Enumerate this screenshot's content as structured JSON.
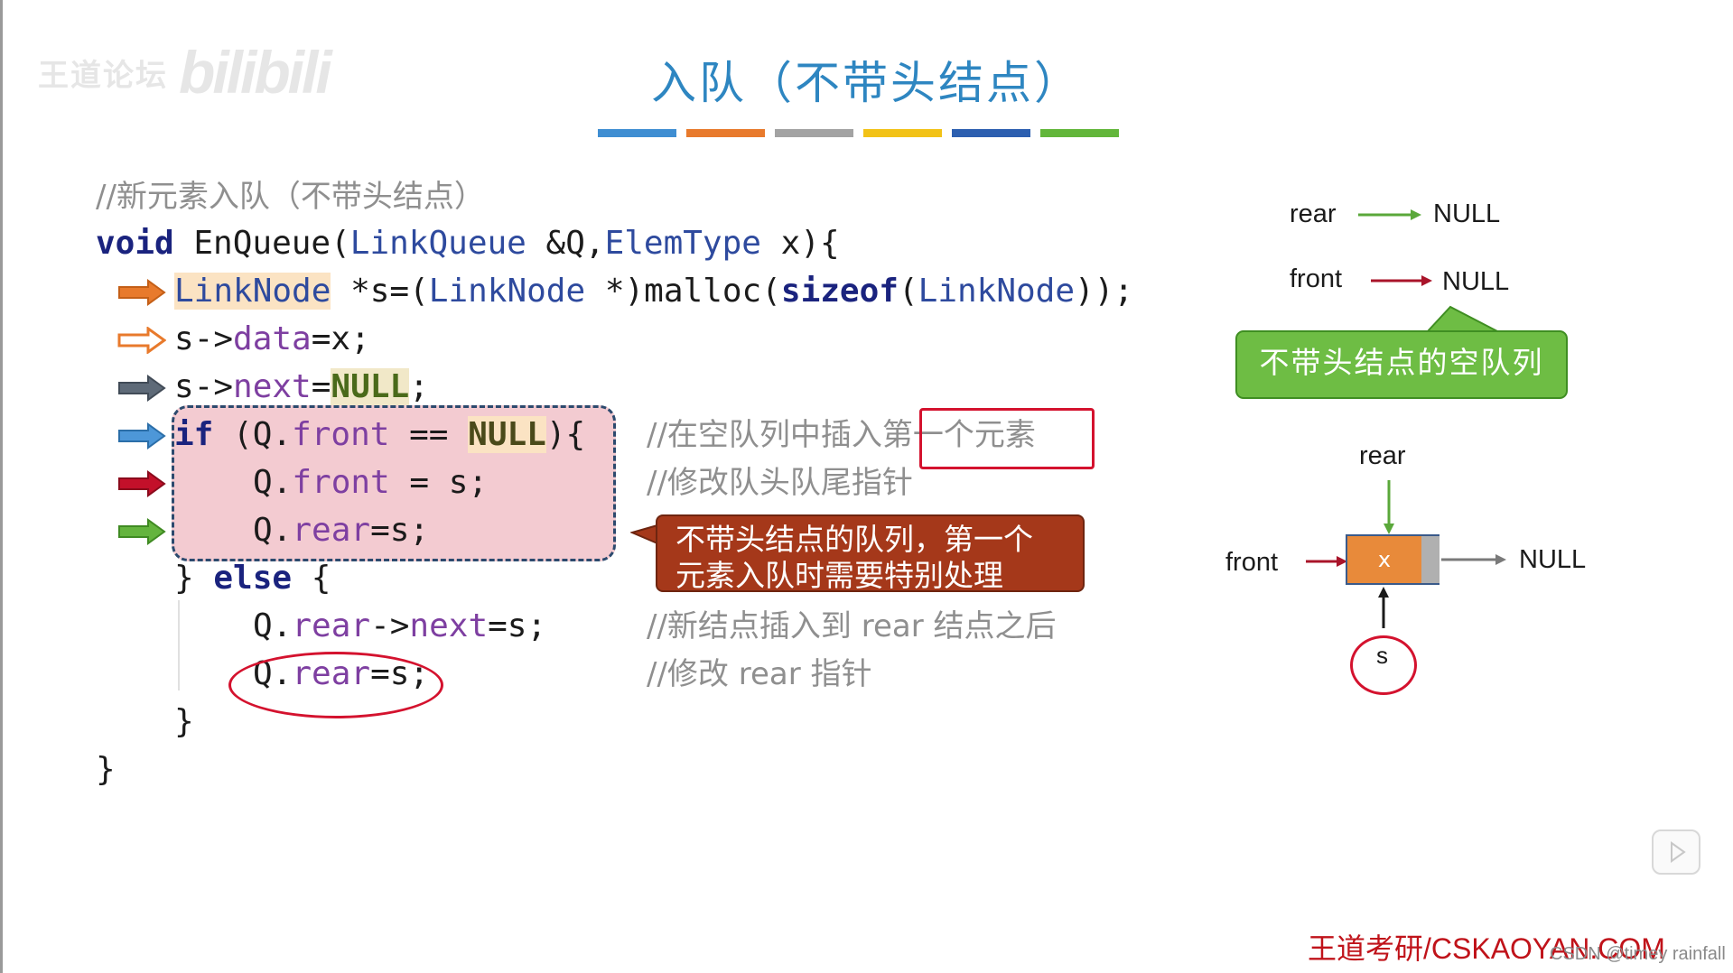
{
  "watermark": {
    "cn": "王道论坛",
    "bili": "bilibili"
  },
  "title": "入队（不带头结点）",
  "color_bar": [
    "#3f8ed2",
    "#e87a2c",
    "#a3a3a3",
    "#f2c217",
    "#2c5fb0",
    "#62b63a"
  ],
  "code": {
    "comment_header": "//新元素入队（不带头结点）",
    "l1": {
      "kw": "void",
      "fn": " EnQueue(",
      "t1": "LinkQueue",
      "p1": " &Q,",
      "t2": "ElemType",
      "p2": " x){"
    },
    "l2": {
      "t1": "LinkNode",
      "p1": " *s=(",
      "t2": "LinkNode",
      "p2": " *)malloc(",
      "kw": "sizeof",
      "p3": "(",
      "t3": "LinkNode",
      "p4": "));"
    },
    "l3": {
      "p1": "s->",
      "f": "data",
      "p2": "=x;"
    },
    "l4": {
      "p1": "s->",
      "f": "next",
      "p2": "=",
      "null": "NULL",
      "p3": ";"
    },
    "l5": {
      "kw": "if",
      "p1": " (Q.",
      "f": "front",
      "p2": " == ",
      "null": "NULL",
      "p3": "){"
    },
    "l6": {
      "p1": "Q.",
      "f": "front",
      "p2": " = s;"
    },
    "l7": {
      "p1": "Q.",
      "f": "rear",
      "p2": "=s;"
    },
    "l8": {
      "p1": "} ",
      "kw": "else",
      "p2": " {"
    },
    "l9": {
      "p1": "Q.",
      "f1": "rear",
      "p2": "->",
      "f2": "next",
      "p3": "=s;"
    },
    "l10": {
      "p1": "Q.",
      "f": "rear",
      "p2": "=s;"
    },
    "l11": "}",
    "l12": "}"
  },
  "comments": {
    "c1": "//在空队列中插入第一个元素",
    "c2": "//修改队头队尾指针",
    "c3": "//新结点插入到 rear 结点之后",
    "c4": "//修改 rear 指针"
  },
  "callout": {
    "line1": "不带头结点的队列，第一个",
    "line2": "元素入队时需要特别处理"
  },
  "diagram": {
    "rear": "rear",
    "front": "front",
    "null": "NULL",
    "bubble": "不带头结点的空队列",
    "node_value": "x",
    "s_label": "s"
  },
  "footer": {
    "site": "王道考研/CSKAOYAN.COM",
    "csdn": "CSDN @timey rainfall"
  }
}
